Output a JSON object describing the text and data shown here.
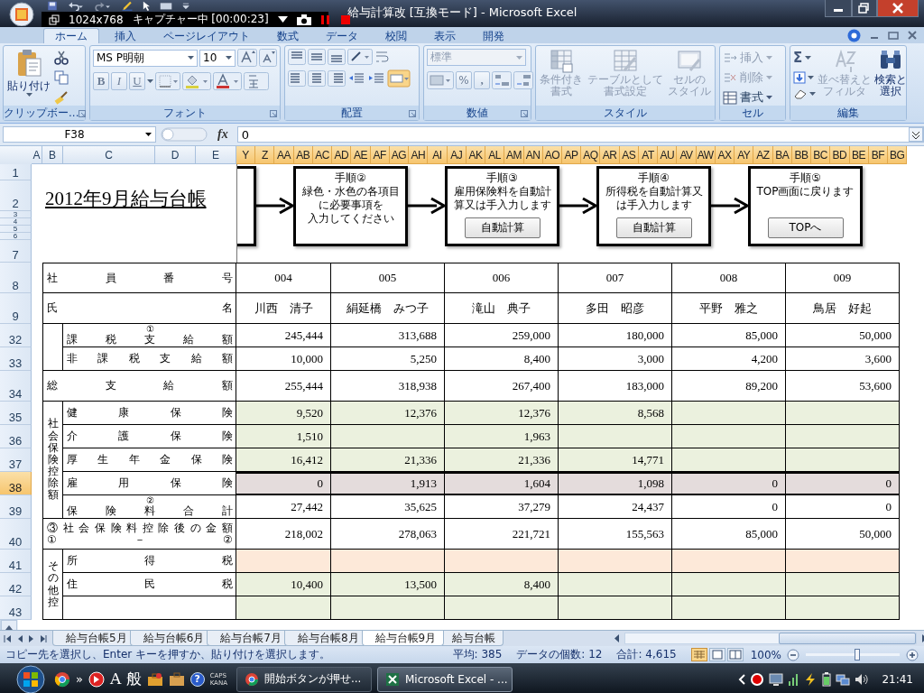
{
  "window": {
    "title": "給与計算改  [互換モード] - Microsoft Excel"
  },
  "capture_bar": {
    "resolution": "1024x768",
    "status": "キャプチャー中 [00:00:23]"
  },
  "ribbon_tabs": [
    {
      "label": "ホーム",
      "selected": true
    },
    {
      "label": "挿入",
      "selected": false
    },
    {
      "label": "ページレイアウト",
      "selected": false
    },
    {
      "label": "数式",
      "selected": false
    },
    {
      "label": "データ",
      "selected": false
    },
    {
      "label": "校閲",
      "selected": false
    },
    {
      "label": "表示",
      "selected": false
    },
    {
      "label": "開発",
      "selected": false
    }
  ],
  "ribbon": {
    "clipboard": {
      "paste": "貼り付け",
      "label": "クリップボー..."
    },
    "font": {
      "name": "MS P明朝",
      "size": "10",
      "styles": [
        "B",
        "I",
        "U"
      ],
      "label": "フォント"
    },
    "alignment": {
      "label": "配置"
    },
    "number": {
      "format": "標準",
      "percent": "%",
      "comma": ",",
      "label": "数値"
    },
    "styles": {
      "buttons": [
        {
          "lines": [
            "条件付き",
            "書式"
          ],
          "disabled": true
        },
        {
          "lines": [
            "テーブルとして",
            "書式設定"
          ],
          "disabled": true
        },
        {
          "lines": [
            "セルの",
            "スタイル"
          ],
          "disabled": true
        }
      ],
      "label": "スタイル"
    },
    "cells": {
      "buttons": [
        {
          "label": "挿入",
          "disabled": true
        },
        {
          "label": "削除",
          "disabled": true
        },
        {
          "label": "書式",
          "disabled": false
        }
      ],
      "label": "セル"
    },
    "editing": {
      "sum": "Σ",
      "buttons": [
        {
          "lines": [
            "並べ替えと",
            "フィルタ"
          ],
          "disabled": true
        },
        {
          "lines": [
            "検索と",
            "選択"
          ],
          "disabled": false
        }
      ],
      "label": "編集"
    }
  },
  "formula_bar": {
    "name_box": "F38",
    "function_label": "fx",
    "value": "0"
  },
  "sheet": {
    "columns": [
      {
        "label": "A",
        "selected": false
      },
      {
        "label": "B",
        "selected": false
      },
      {
        "label": "C",
        "selected": false
      },
      {
        "label": "D",
        "selected": false
      },
      {
        "label": "E",
        "selected": false
      },
      {
        "label": "Y",
        "selected": true
      },
      {
        "label": "Z",
        "selected": true
      },
      {
        "label": "AA",
        "selected": true
      },
      {
        "label": "AB",
        "selected": true
      },
      {
        "label": "AC",
        "selected": true
      },
      {
        "label": "AD",
        "selected": true
      },
      {
        "label": "AE",
        "selected": true
      },
      {
        "label": "AF",
        "selected": true
      },
      {
        "label": "AG",
        "selected": true
      },
      {
        "label": "AH",
        "selected": true
      },
      {
        "label": "AI",
        "selected": true
      },
      {
        "label": "AJ",
        "selected": true
      },
      {
        "label": "AK",
        "selected": true
      },
      {
        "label": "AL",
        "selected": true
      },
      {
        "label": "AM",
        "selected": true
      },
      {
        "label": "AN",
        "selected": true
      },
      {
        "label": "AO",
        "selected": true
      },
      {
        "label": "AP",
        "selected": true
      },
      {
        "label": "AQ",
        "selected": true
      },
      {
        "label": "AR",
        "selected": true
      },
      {
        "label": "AS",
        "selected": true
      },
      {
        "label": "AT",
        "selected": true
      },
      {
        "label": "AU",
        "selected": true
      },
      {
        "label": "AV",
        "selected": true
      },
      {
        "label": "AW",
        "selected": true
      },
      {
        "label": "AX",
        "selected": true
      },
      {
        "label": "AY",
        "selected": true
      },
      {
        "label": "AZ",
        "selected": true
      },
      {
        "label": "BA",
        "selected": true
      },
      {
        "label": "BB",
        "selected": true
      },
      {
        "label": "BC",
        "selected": true
      },
      {
        "label": "BD",
        "selected": true
      },
      {
        "label": "BE",
        "selected": true
      },
      {
        "label": "BF",
        "selected": true
      },
      {
        "label": "BG",
        "selected": true
      }
    ],
    "top_rows": [
      "1",
      "2",
      "3",
      "4",
      "5",
      "6",
      "7"
    ],
    "title": "2012年9月給与台帳",
    "flow": [
      {
        "kind": "cut"
      },
      {
        "kind": "step",
        "lines": [
          "手順②",
          "緑色・水色の各項目",
          "に必要事項を",
          "入力してください"
        ]
      },
      {
        "kind": "step",
        "lines": [
          "手順③",
          "雇用保険料を自動計",
          "算又は手入力します"
        ],
        "button": "自動計算"
      },
      {
        "kind": "step",
        "lines": [
          "手順④",
          "所得税を自動計算又",
          "は手入力します"
        ],
        "button": "自動計算"
      },
      {
        "kind": "step",
        "lines": [
          "手順⑤",
          "TOP画面に戻ります"
        ],
        "button": "TOPへ"
      }
    ],
    "sections": [
      {
        "kind": "plain",
        "rows": [
          {
            "header": "8",
            "kind": "header",
            "label": "社員番号",
            "values": [
              "004",
              "005",
              "006",
              "007",
              "008",
              "009"
            ],
            "selected": false
          },
          {
            "header": "9",
            "kind": "header",
            "label": "氏名",
            "values": [
              "川西　清子",
              "絹延橋　みつ子",
              "滝山　典子",
              "多田　昭彦",
              "平野　雅之",
              "鳥居　好起"
            ],
            "selected": false
          }
        ]
      },
      {
        "kind": "group",
        "rows": [
          {
            "header": "32",
            "kind": "amount",
            "note": "①",
            "label": "課税支給額",
            "values": [
              "245,444",
              "313,688",
              "259,000",
              "180,000",
              "85,000",
              "50,000"
            ],
            "selected": false
          },
          {
            "header": "33",
            "kind": "amount",
            "label": "非課税支給額",
            "values": [
              "10,000",
              "5,250",
              "8,400",
              "3,000",
              "4,200",
              "3,600"
            ],
            "selected": false
          }
        ]
      },
      {
        "kind": "plain",
        "rows": [
          {
            "header": "34",
            "kind": "amount",
            "label": "総支給額",
            "values": [
              "255,444",
              "318,938",
              "267,400",
              "183,000",
              "89,200",
              "53,600"
            ],
            "selected": false
          }
        ]
      },
      {
        "kind": "group",
        "label": "社会保険控除額",
        "rows": [
          {
            "header": "35",
            "kind": "input",
            "label": "健康保険",
            "cells": [
              {
                "kind": "value",
                "text": "9,520"
              },
              {
                "kind": "value",
                "text": "12,376"
              },
              {
                "kind": "value",
                "text": "12,376"
              },
              {
                "kind": "value",
                "text": "8,568"
              },
              {
                "kind": "blank"
              },
              {
                "kind": "blank"
              }
            ],
            "selected": false
          },
          {
            "header": "36",
            "kind": "input",
            "label": "介護保険",
            "cells": [
              {
                "kind": "value",
                "text": "1,510"
              },
              {
                "kind": "blank"
              },
              {
                "kind": "value",
                "text": "1,963"
              },
              {
                "kind": "blank"
              },
              {
                "kind": "blank"
              },
              {
                "kind": "blank"
              }
            ],
            "selected": false
          },
          {
            "header": "37",
            "kind": "input",
            "label": "厚生年金保険",
            "cells": [
              {
                "kind": "value",
                "text": "16,412"
              },
              {
                "kind": "value",
                "text": "21,336"
              },
              {
                "kind": "value",
                "text": "21,336"
              },
              {
                "kind": "value",
                "text": "14,771"
              },
              {
                "kind": "blank"
              },
              {
                "kind": "blank"
              }
            ],
            "selected": false
          },
          {
            "header": "38",
            "kind": "amount",
            "label": "雇用保険",
            "values": [
              "0",
              "1,913",
              "1,604",
              "1,098",
              "0",
              "0"
            ],
            "selected": true
          },
          {
            "header": "39",
            "kind": "amount",
            "note": "②",
            "label": "保険料合計",
            "values": [
              "27,442",
              "35,625",
              "37,279",
              "24,437",
              "0",
              "0"
            ],
            "selected": false
          }
        ]
      },
      {
        "kind": "plain",
        "rows": [
          {
            "header": "40",
            "kind": "amount",
            "label": "③社会保険料控除後の金額",
            "label_line2": "①－②",
            "values": [
              "218,002",
              "278,063",
              "221,721",
              "155,563",
              "85,000",
              "50,000"
            ],
            "selected": false
          }
        ]
      },
      {
        "kind": "group",
        "label": "その他控",
        "rows": [
          {
            "header": "41",
            "kind": "computed",
            "label": "所得税",
            "selected": false
          },
          {
            "header": "42",
            "kind": "input",
            "label": "住民税",
            "cells": [
              {
                "kind": "value",
                "text": "10,400"
              },
              {
                "kind": "value",
                "text": "13,500"
              },
              {
                "kind": "value",
                "text": "8,400"
              },
              {
                "kind": "blank"
              },
              {
                "kind": "blank"
              },
              {
                "kind": "blank"
              }
            ],
            "selected": false
          },
          {
            "header": "43",
            "kind": "input",
            "selected": false
          }
        ]
      }
    ]
  },
  "sheet_tabs": [
    {
      "label": "給与台帳5月",
      "selected": false
    },
    {
      "label": "給与台帳6月",
      "selected": false
    },
    {
      "label": "給与台帳7月",
      "selected": false
    },
    {
      "label": "給与台帳8月",
      "selected": false
    },
    {
      "label": "給与台帳9月",
      "selected": true
    },
    {
      "label": "給与台帳",
      "selected": false
    }
  ],
  "status_bar": {
    "message": "コピー先を選択し、Enter キーを押すか、貼り付けを選択します。",
    "average": "平均: 385",
    "count": "データの個数: 12",
    "sum": "合計: 4,615",
    "zoom": "100%",
    "zoom_slider": {
      "level": 0.55
    }
  },
  "taskbar": {
    "more": "»",
    "ime": "A",
    "ime_mode": "般",
    "help": "?",
    "caps": "CAPS",
    "kana": "KANA",
    "tasks": [
      {
        "label": "開始ボタンが押せ...",
        "selected": false
      },
      {
        "label": "Microsoft Excel - ...",
        "selected": true
      }
    ],
    "time": "21:41"
  }
}
